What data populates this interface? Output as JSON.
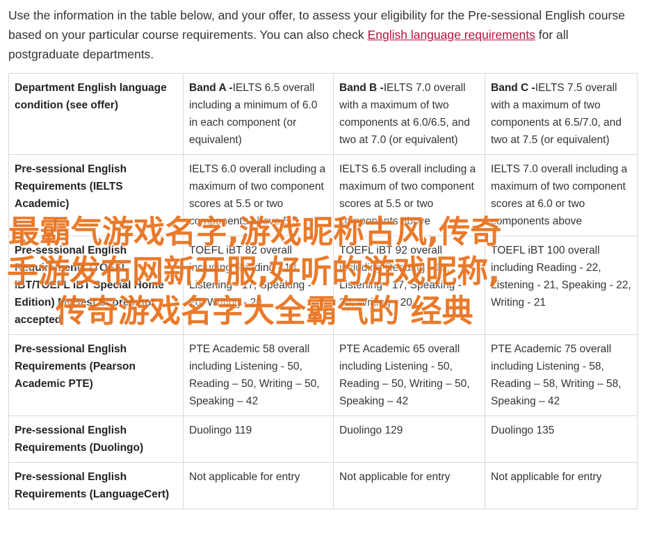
{
  "intro": {
    "text_before": "Use the information in the table below, and your offer, to assess your eligibility for the Pre-sessional English course based on your particular course requirements. You can also check ",
    "link_label": "English language requirements",
    "text_after": " for all postgraduate departments."
  },
  "table": {
    "header": {
      "label": "Department English language condition (see offer)",
      "bands": [
        {
          "name": "Band A -",
          "desc": "IELTS 6.5 overall including a minimum of 6.0 in each component (or equivalent)"
        },
        {
          "name": "Band B -",
          "desc": "IELTS 7.0 overall with a maximum of two components at 6.0/6.5, and two at 7.0 (or equivalent)"
        },
        {
          "name": "Band C -",
          "desc": "IELTS 7.5 overall with a maximum of two components at 6.5/7.0, and two at 7.5 (or equivalent)"
        }
      ]
    },
    "rows": [
      {
        "label": "Pre-sessional English Requirements (IELTS Academic)",
        "values": [
          "IELTS 6.0 overall including a maximum of two component scores at 5.5 or two components above 5.5",
          "IELTS 6.5 overall including a maximum of two component scores at 5.5 or two components above",
          "IELTS 7.0 overall including a maximum of two component scores at 6.0 or two components above"
        ]
      },
      {
        "label": "Pre-sessional English Requirements (TOEFL iBT/TOEFL iBT Special Home Edition) MyBest Scores not accepted",
        "values": [
          "TOEFL iBT 82 overall including Reading - 18, Listening - 17, Speaking - 20, Writing - 20",
          "TOEFL iBT 92 overall including Reading - 18, Listening - 17, Speaking - 20, Writing - 20",
          "TOEFL iBT 100 overall including Reading - 22, Listening - 21, Speaking - 22, Writing - 21"
        ]
      },
      {
        "label": "Pre-sessional English Requirements (Pearson Academic PTE)",
        "values": [
          "PTE Academic 58 overall including Listening - 50, Reading – 50, Writing – 50, Speaking – 42",
          "PTE Academic 65 overall including Listening - 50, Reading – 50, Writing – 50, Speaking – 42",
          "PTE Academic 75 overall including Listening - 58, Reading – 58, Writing – 58, Speaking – 42"
        ]
      },
      {
        "label": "Pre-sessional English Requirements (Duolingo)",
        "values": [
          "Duolingo 119",
          "Duolingo 129",
          "Duolingo 135"
        ]
      },
      {
        "label": "Pre-sessional English Requirements (LanguageCert)",
        "values": [
          "Not applicable for entry",
          "Not applicable for entry",
          "Not applicable for entry"
        ]
      }
    ]
  },
  "watermark": {
    "line1": "最霸气游戏名字,游戏昵称古风,传奇",
    "line2": "手游发布网新开服,好听的游戏昵称,",
    "line3": "传奇游戏名字大全霸气的 经典"
  },
  "colors": {
    "link": "#b5123e",
    "watermark": "#e8701b",
    "border": "#d7d7d7",
    "text": "#333333"
  }
}
